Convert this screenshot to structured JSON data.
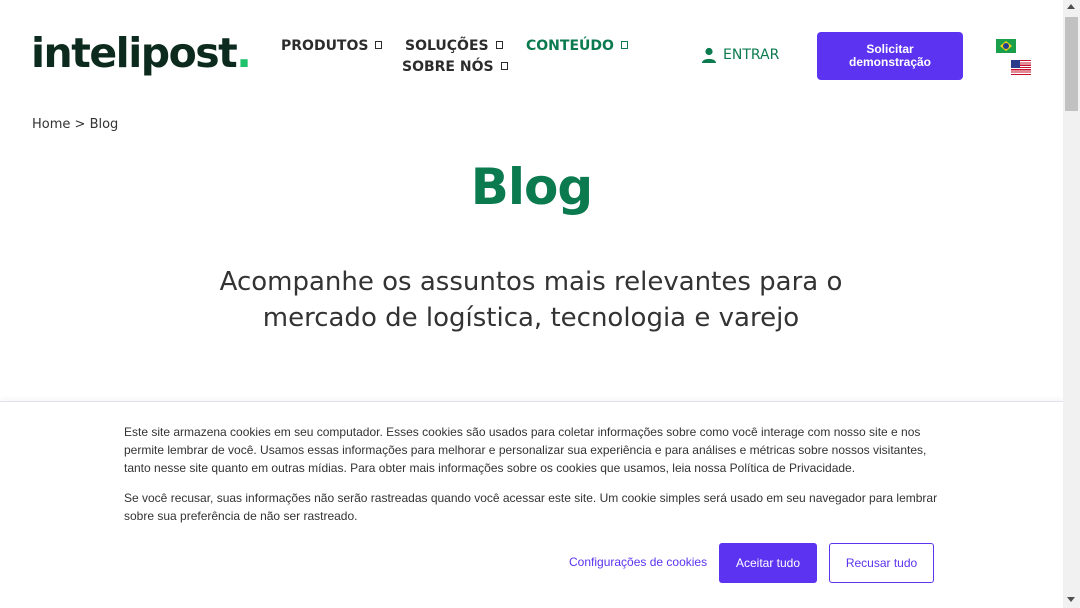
{
  "header": {
    "logo_text": "intelipost",
    "logo_dot": ".",
    "nav": [
      {
        "label": "PRODUTOS"
      },
      {
        "label": "SOLUÇÕES"
      },
      {
        "label": "CONTEÚDO"
      },
      {
        "label": "SOBRE NÓS"
      }
    ],
    "login_label": "ENTRAR",
    "demo_button": "Solicitar demonstração",
    "languages": [
      "pt-BR",
      "en-US"
    ]
  },
  "breadcrumb": {
    "home": "Home",
    "separator": ">",
    "current": "Blog"
  },
  "main": {
    "title": "Blog",
    "subtitle": "Acompanhe os assuntos mais relevantes para o mercado de logística, tecnologia e varejo"
  },
  "cookie_banner": {
    "text1": "Este site armazena cookies em seu computador. Esses cookies são usados para coletar informações sobre como você interage com nosso site e nos permite lembrar de você. Usamos essas informações para melhorar e personalizar sua experiência e para análises e métricas sobre nossos visitantes, tanto nesse site quanto em outras mídias. Para obter mais informações sobre os cookies que usamos, leia nossa Política de Privacidade.",
    "text2": "Se você recusar, suas informações não serão rastreadas quando você acessar este site. Um cookie simples será usado em seu navegador para lembrar sobre sua preferência de não ser rastreado.",
    "settings_label": "Configurações de cookies",
    "accept_label": "Aceitar tudo",
    "reject_label": "Recusar tudo"
  },
  "colors": {
    "brand_green": "#0b7a4f",
    "accent_purple": "#5b33f0",
    "logo_dark": "#0d2a1e",
    "logo_dot": "#1fc16b"
  },
  "icons": {
    "login": "user-icon",
    "nav_caret": "chevron-down-icon",
    "flag_br": "flag-brazil-icon",
    "flag_us": "flag-usa-icon"
  }
}
